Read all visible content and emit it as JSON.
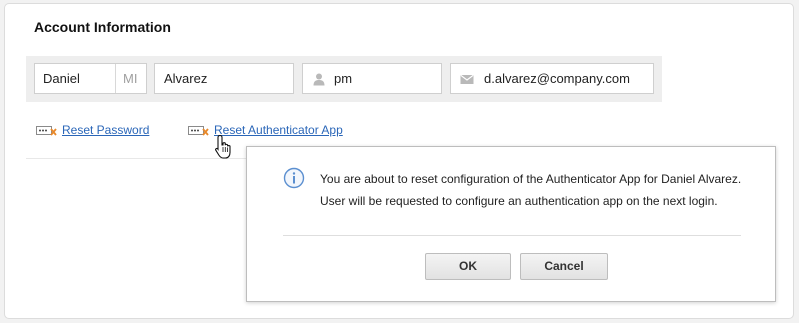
{
  "section": {
    "title": "Account Information"
  },
  "fields": {
    "first_name": "Daniel",
    "middle_initial_placeholder": "MI",
    "last_name": "Alvarez",
    "username": "pm",
    "email": "d.alvarez@company.com"
  },
  "links": {
    "reset_password": "Reset Password",
    "reset_authenticator": "Reset Authenticator App"
  },
  "dialog": {
    "line1": "You are about to reset configuration of the Authenticator App for Daniel Alvarez.",
    "line2": "User will be requested to configure an authentication app on the next login.",
    "ok_label": "OK",
    "cancel_label": "Cancel"
  },
  "icons": {
    "user": "user-icon",
    "email": "envelope-icon",
    "reset": "password-reset-icon",
    "info": "info-icon",
    "cursor": "hand-pointer-icon"
  },
  "colors": {
    "link": "#2a66b8",
    "info_icon": "#5b8fd0",
    "reset_icon_accent": "#e8892b"
  }
}
